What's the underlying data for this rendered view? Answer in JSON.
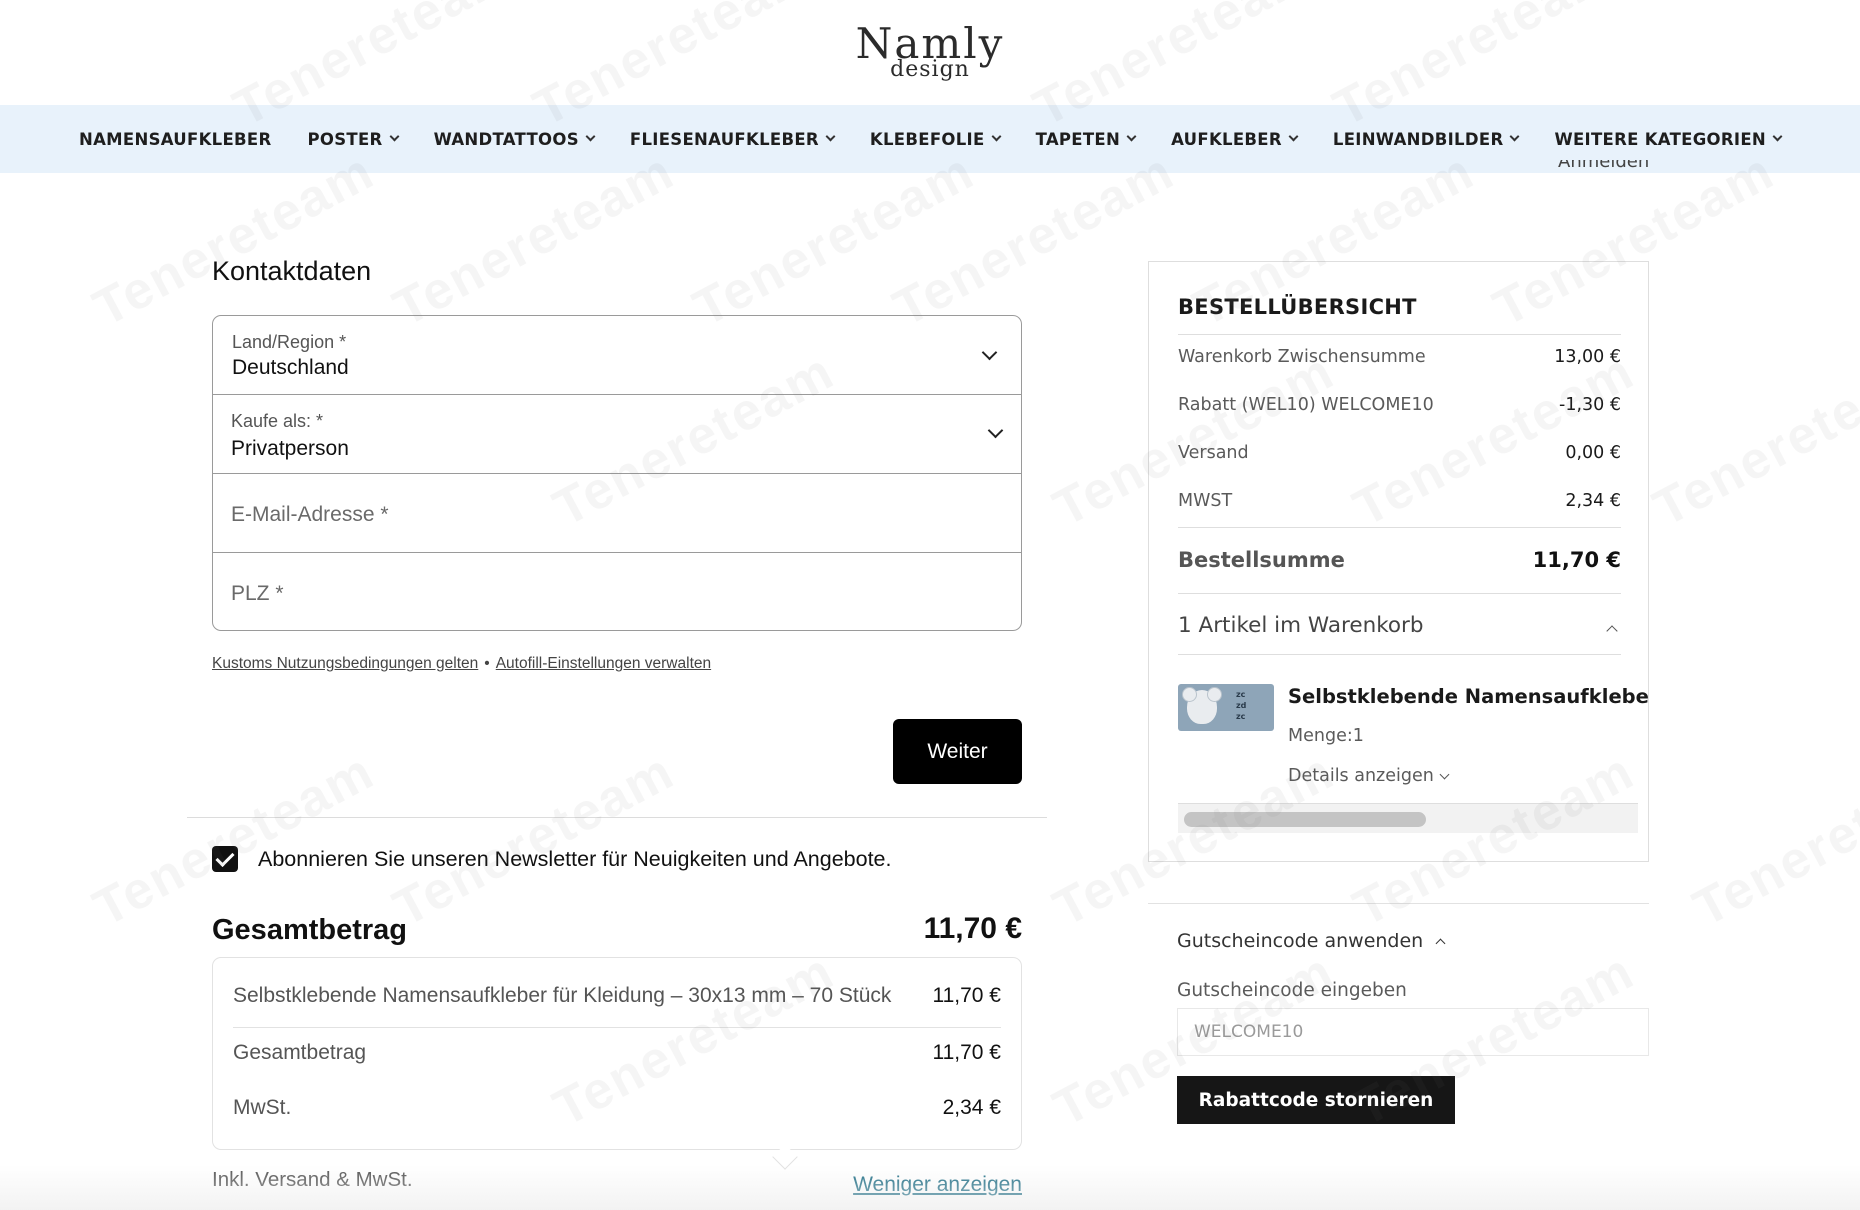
{
  "logo": {
    "line1": "Namly",
    "line2": "design"
  },
  "nav": {
    "items": [
      {
        "label": "NAMENSAUFKLEBER",
        "has_dropdown": false
      },
      {
        "label": "POSTER",
        "has_dropdown": true
      },
      {
        "label": "WANDTATTOOS",
        "has_dropdown": true
      },
      {
        "label": "FLIESENAUFKLEBER",
        "has_dropdown": true
      },
      {
        "label": "KLEBEFOLIE",
        "has_dropdown": true
      },
      {
        "label": "TAPETEN",
        "has_dropdown": true
      },
      {
        "label": "AUFKLEBER",
        "has_dropdown": true
      },
      {
        "label": "LEINWANDBILDER",
        "has_dropdown": true
      },
      {
        "label": "WEITERE KATEGORIEN",
        "has_dropdown": true
      }
    ],
    "login_label": "Anmelden"
  },
  "contact": {
    "title": "Kontaktdaten",
    "country": {
      "label": "Land/Region *",
      "value": "Deutschland"
    },
    "buyer_type": {
      "label": "Kaufe als: *",
      "value": "Privatperson"
    },
    "email": {
      "placeholder": "E-Mail-Adresse *"
    },
    "zip": {
      "placeholder": "PLZ *"
    },
    "legal_link_1": "Kustoms Nutzungsbedingungen gelten",
    "legal_sep": "•",
    "legal_link_2": "Autofill-Einstellungen verwalten",
    "continue_label": "Weiter"
  },
  "newsletter": {
    "checked": true,
    "label": "Abonnieren Sie unseren Newsletter für Neuigkeiten und Angebote."
  },
  "summary_left": {
    "title": "Gesamtbetrag",
    "total": "11,70 €",
    "rows": [
      {
        "label": "Selbstklebende Namensaufkleber für Kleidung – 30x13 mm – 70 Stück",
        "value": "11,70 €"
      },
      {
        "label": "Gesamtbetrag",
        "value": "11,70 €"
      },
      {
        "label": "MwSt.",
        "value": "2,34 €"
      }
    ],
    "incl_note": "Inkl. Versand & MwSt.",
    "toggle_label": "Weniger anzeigen"
  },
  "order_overview": {
    "title": "BESTELLÜBERSICHT",
    "rows": [
      {
        "label": "Warenkorb Zwischensumme",
        "value": "13,00 €"
      },
      {
        "label": "Rabatt (WEL10) WELCOME10",
        "value": "-1,30 €"
      },
      {
        "label": "Versand",
        "value": "0,00 €"
      },
      {
        "label": "MWST",
        "value": "2,34 €"
      }
    ],
    "total_label": "Bestellsumme",
    "total_value": "11,70 €",
    "items_count_label": "1 Artikel im Warenkorb",
    "item": {
      "name": "Selbstklebende Namensaufkleber für",
      "qty": "Menge:1",
      "details_label": "Details anzeigen",
      "thumb_text": [
        "zc",
        "zd",
        "zc"
      ]
    },
    "scroll_fraction": 0.54
  },
  "coupon": {
    "toggle_label": "Gutscheincode anwenden",
    "input_label": "Gutscheincode eingeben",
    "input_value": "WELCOME10",
    "cancel_label": "Rabattcode stornieren"
  },
  "watermark": {
    "text": "Tenereteam"
  }
}
